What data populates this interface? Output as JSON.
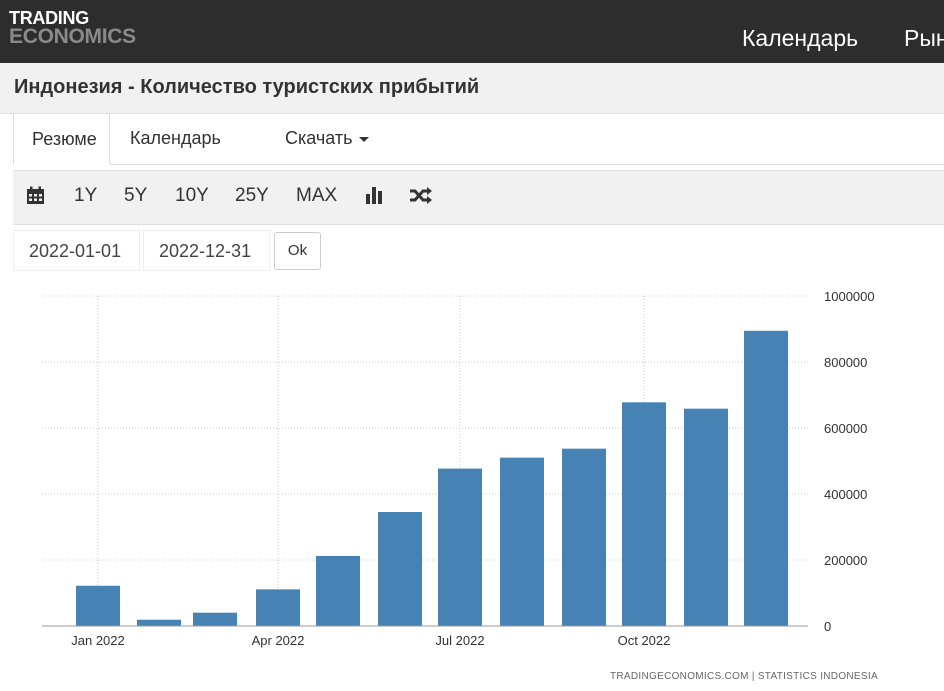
{
  "header": {
    "logo_line1": "TRADING",
    "logo_line2": "ECONOMICS",
    "nav": [
      "Календарь",
      "Рын"
    ]
  },
  "page": {
    "title": "Индонезия - Количество туристских прибытий"
  },
  "tabs": {
    "summary": "Резюме",
    "calendar": "Календарь",
    "download": "Скачать"
  },
  "toolbar": {
    "ranges": [
      "1Y",
      "5Y",
      "10Y",
      "25Y",
      "MAX"
    ],
    "icons": [
      "calendar-icon",
      "bar-chart-icon",
      "shuffle-icon"
    ]
  },
  "date_range": {
    "start": "2022-01-01",
    "end": "2022-12-31",
    "ok_label": "Ok"
  },
  "credit": "TRADINGECONOMICS.COM  |  STATISTICS INDONESIA",
  "colors": {
    "bar": "#4682b4",
    "topbar": "#2d2d2d",
    "logo_gray": "#8a8a8a"
  },
  "chart_data": {
    "type": "bar",
    "title": "",
    "xlabel": "",
    "ylabel": "",
    "categories": [
      "Jan 2022",
      "Feb 2022",
      "Mar 2022",
      "Apr 2022",
      "May 2022",
      "Jun 2022",
      "Jul 2022",
      "Aug 2022",
      "Sep 2022",
      "Oct 2022",
      "Nov 2022",
      "Dec 2022"
    ],
    "values": [
      121978,
      18976,
      40300,
      111057,
      212309,
      345438,
      476970,
      510223,
      537339,
      677824,
      658554,
      894656
    ],
    "x_tick_labels": [
      "Jan 2022",
      "Apr 2022",
      "Jul 2022",
      "Oct 2022"
    ],
    "y_ticks": [
      0,
      200000,
      400000,
      600000,
      800000,
      1000000
    ],
    "ylim": [
      0,
      1000000
    ],
    "grid": true,
    "y_axis_side": "right"
  }
}
